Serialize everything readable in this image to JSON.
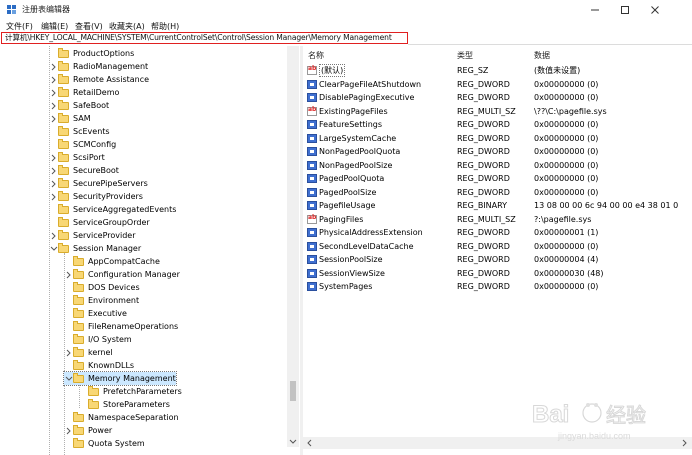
{
  "window": {
    "title": "注册表编辑器"
  },
  "menubar": {
    "items": [
      "文件(F)",
      "编辑(E)",
      "查看(V)",
      "收藏夹(A)",
      "帮助(H)"
    ]
  },
  "address": {
    "path": "计算机\\HKEY_LOCAL_MACHINE\\SYSTEM\\CurrentControlSet\\Control\\Session Manager\\Memory Management"
  },
  "tree": {
    "items": [
      {
        "label": "ProductOptions",
        "depth": 0,
        "expander": ""
      },
      {
        "label": "RadioManagement",
        "depth": 0,
        "expander": ">"
      },
      {
        "label": "Remote Assistance",
        "depth": 0,
        "expander": ">"
      },
      {
        "label": "RetailDemo",
        "depth": 0,
        "expander": ">"
      },
      {
        "label": "SafeBoot",
        "depth": 0,
        "expander": ">"
      },
      {
        "label": "SAM",
        "depth": 0,
        "expander": ">"
      },
      {
        "label": "ScEvents",
        "depth": 0,
        "expander": ""
      },
      {
        "label": "SCMConfig",
        "depth": 0,
        "expander": ""
      },
      {
        "label": "ScsiPort",
        "depth": 0,
        "expander": ">"
      },
      {
        "label": "SecureBoot",
        "depth": 0,
        "expander": ">"
      },
      {
        "label": "SecurePipeServers",
        "depth": 0,
        "expander": ">"
      },
      {
        "label": "SecurityProviders",
        "depth": 0,
        "expander": ">"
      },
      {
        "label": "ServiceAggregatedEvents",
        "depth": 0,
        "expander": ""
      },
      {
        "label": "ServiceGroupOrder",
        "depth": 0,
        "expander": ""
      },
      {
        "label": "ServiceProvider",
        "depth": 0,
        "expander": ">"
      },
      {
        "label": "Session Manager",
        "depth": 0,
        "expander": "v"
      },
      {
        "label": "AppCompatCache",
        "depth": 1,
        "expander": ""
      },
      {
        "label": "Configuration Manager",
        "depth": 1,
        "expander": ">"
      },
      {
        "label": "DOS Devices",
        "depth": 1,
        "expander": ""
      },
      {
        "label": "Environment",
        "depth": 1,
        "expander": ""
      },
      {
        "label": "Executive",
        "depth": 1,
        "expander": ""
      },
      {
        "label": "FileRenameOperations",
        "depth": 1,
        "expander": ""
      },
      {
        "label": "I/O System",
        "depth": 1,
        "expander": ""
      },
      {
        "label": "kernel",
        "depth": 1,
        "expander": ">"
      },
      {
        "label": "KnownDLLs",
        "depth": 1,
        "expander": ""
      },
      {
        "label": "Memory Management",
        "depth": 1,
        "expander": "v",
        "selected": true
      },
      {
        "label": "PrefetchParameters",
        "depth": 2,
        "expander": ""
      },
      {
        "label": "StoreParameters",
        "depth": 2,
        "expander": ""
      },
      {
        "label": "NamespaceSeparation",
        "depth": 1,
        "expander": ""
      },
      {
        "label": "Power",
        "depth": 1,
        "expander": ">"
      },
      {
        "label": "Quota System",
        "depth": 1,
        "expander": ""
      }
    ]
  },
  "values": {
    "headers": {
      "name": "名称",
      "type": "类型",
      "data": "数据"
    },
    "rows": [
      {
        "name": "(默认)",
        "type": "REG_SZ",
        "data": "(数值未设置)",
        "icon": "string"
      },
      {
        "name": "ClearPageFileAtShutdown",
        "type": "REG_DWORD",
        "data": "0x00000000 (0)",
        "icon": "binary"
      },
      {
        "name": "DisablePagingExecutive",
        "type": "REG_DWORD",
        "data": "0x00000000 (0)",
        "icon": "binary"
      },
      {
        "name": "ExistingPageFiles",
        "type": "REG_MULTI_SZ",
        "data": "\\??\\C:\\pagefile.sys",
        "icon": "string"
      },
      {
        "name": "FeatureSettings",
        "type": "REG_DWORD",
        "data": "0x00000000 (0)",
        "icon": "binary"
      },
      {
        "name": "LargeSystemCache",
        "type": "REG_DWORD",
        "data": "0x00000000 (0)",
        "icon": "binary"
      },
      {
        "name": "NonPagedPoolQuota",
        "type": "REG_DWORD",
        "data": "0x00000000 (0)",
        "icon": "binary"
      },
      {
        "name": "NonPagedPoolSize",
        "type": "REG_DWORD",
        "data": "0x00000000 (0)",
        "icon": "binary"
      },
      {
        "name": "PagedPoolQuota",
        "type": "REG_DWORD",
        "data": "0x00000000 (0)",
        "icon": "binary"
      },
      {
        "name": "PagedPoolSize",
        "type": "REG_DWORD",
        "data": "0x00000000 (0)",
        "icon": "binary"
      },
      {
        "name": "PagefileUsage",
        "type": "REG_BINARY",
        "data": "13 08 00 00 6c 94 00 00 e4 38 01 0",
        "icon": "binary"
      },
      {
        "name": "PagingFiles",
        "type": "REG_MULTI_SZ",
        "data": "?:\\pagefile.sys",
        "icon": "string"
      },
      {
        "name": "PhysicalAddressExtension",
        "type": "REG_DWORD",
        "data": "0x00000001 (1)",
        "icon": "binary"
      },
      {
        "name": "SecondLevelDataCache",
        "type": "REG_DWORD",
        "data": "0x00000000 (0)",
        "icon": "binary"
      },
      {
        "name": "SessionPoolSize",
        "type": "REG_DWORD",
        "data": "0x00000004 (4)",
        "icon": "binary"
      },
      {
        "name": "SessionViewSize",
        "type": "REG_DWORD",
        "data": "0x00000030 (48)",
        "icon": "binary"
      },
      {
        "name": "SystemPages",
        "type": "REG_DWORD",
        "data": "0x00000000 (0)",
        "icon": "binary"
      }
    ]
  },
  "watermark": {
    "brand": "Baidu经验",
    "url": "jingyan.baidu.com"
  }
}
